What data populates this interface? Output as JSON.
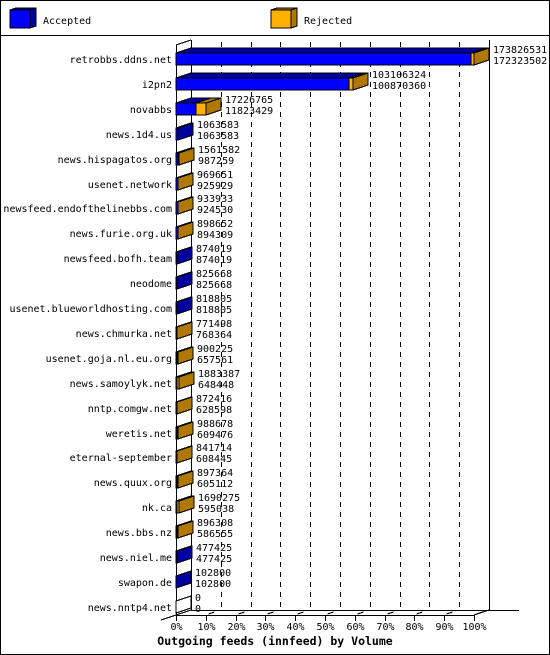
{
  "legend": [
    {
      "label": "Accepted",
      "color": "#0000FF",
      "shade": "#0000A0"
    },
    {
      "label": "Rejected",
      "color": "#FFB000",
      "shade": "#B07800"
    }
  ],
  "colors": {
    "accepted": "#0000FF",
    "accepted_dark": "#0000A0",
    "rejected": "#FFB000",
    "rejected_dark": "#B07800",
    "axis": "#000000",
    "background": "#FFFFFF"
  },
  "chart_data": {
    "type": "bar",
    "orientation": "horizontal",
    "style": "3d",
    "title": "Outgoing feeds (innfeed) by Volume",
    "xlabel": "",
    "ylabel": "",
    "xlim": [
      0,
      100
    ],
    "x_unit": "% of largest value",
    "xticks": [
      "0%",
      "10%",
      "20%",
      "30%",
      "40%",
      "50%",
      "60%",
      "70%",
      "80%",
      "90%",
      "100%"
    ],
    "grid": true,
    "legend_position": "top",
    "categories": [
      "retrobbs.ddns.net",
      "i2pn2",
      "novabbs",
      "news.1d4.us",
      "news.hispagatos.org",
      "usenet.network",
      "newsfeed.endofthelinebbs.com",
      "news.furie.org.uk",
      "newsfeed.bofh.team",
      "neodome",
      "usenet.blueworldhosting.com",
      "news.chmurka.net",
      "usenet.goja.nl.eu.org",
      "news.samoylyk.net",
      "nntp.comgw.net",
      "weretis.net",
      "eternal-september",
      "news.quux.org",
      "nk.ca",
      "news.bbs.nz",
      "news.niel.me",
      "swapon.de",
      "news.nntp4.net"
    ],
    "series": [
      {
        "name": "Accepted",
        "color": "#0000FF",
        "label_position": "lower",
        "values": [
          172323502,
          100870360,
          11823429,
          1063583,
          987259,
          925929,
          924530,
          894309,
          874019,
          825668,
          818805,
          768364,
          657561,
          648448,
          628598,
          609476,
          608445,
          605112,
          595038,
          586555,
          477425,
          102800,
          0
        ]
      },
      {
        "name": "Rejected",
        "color": "#FFB000",
        "label_position": "upper",
        "values": [
          173826531,
          103106324,
          17226765,
          1063583,
          1561582,
          969651,
          933933,
          898652,
          874019,
          825668,
          818805,
          771498,
          900225,
          1883387,
          872416,
          988678,
          841714,
          897364,
          1690275,
          896308,
          477425,
          102800,
          0
        ]
      }
    ]
  }
}
